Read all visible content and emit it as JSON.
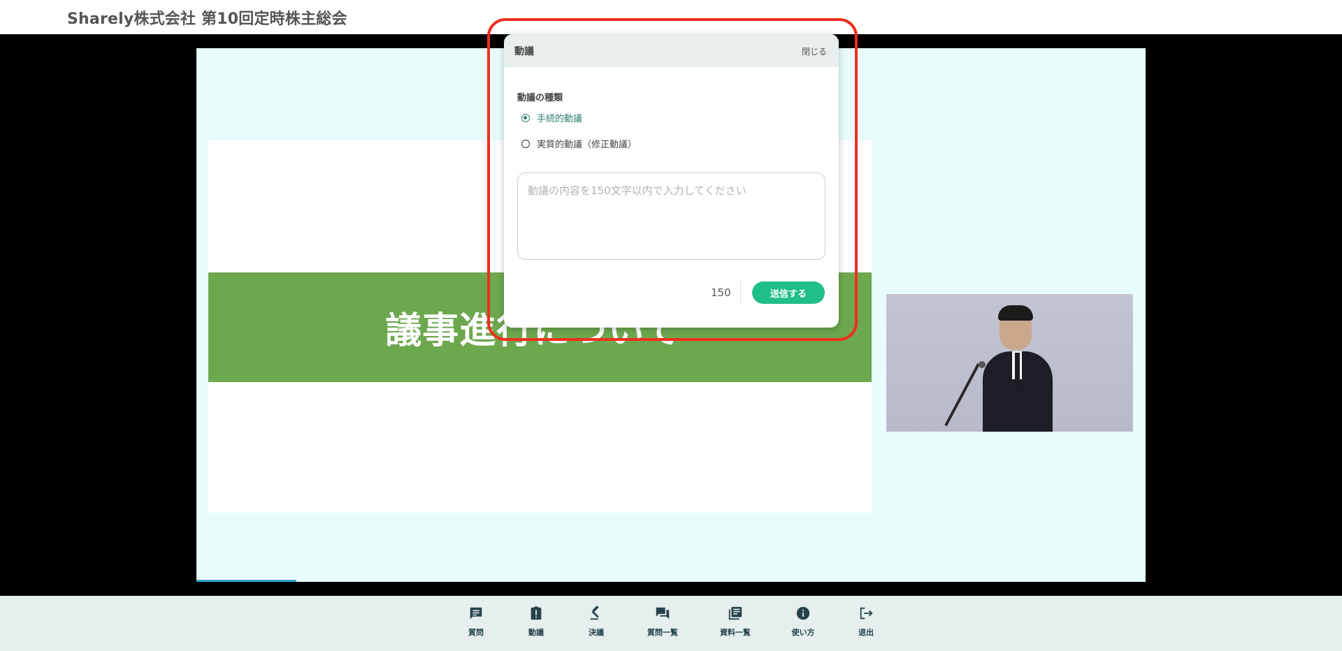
{
  "header": {
    "title": "Sharely株式会社 第10回定時株主総会"
  },
  "slide": {
    "band_text": "議事進行について"
  },
  "dialog": {
    "title": "動議",
    "close_label": "閉じる",
    "section_label": "動議の種類",
    "options": [
      {
        "label": "手続的動議",
        "selected": true
      },
      {
        "label": "実質的動議（修正動議）",
        "selected": false
      }
    ],
    "textarea": {
      "value": "",
      "placeholder": "動議の内容を150文字以内で入力してください"
    },
    "char_count": "150",
    "submit_label": "送信する"
  },
  "toolbar": {
    "items": [
      {
        "label": "質問",
        "icon": "chat-icon"
      },
      {
        "label": "動議",
        "icon": "clipboard-alert-icon"
      },
      {
        "label": "決議",
        "icon": "gavel-icon"
      },
      {
        "label": "質問一覧",
        "icon": "forum-icon"
      },
      {
        "label": "資料一覧",
        "icon": "library-icon"
      },
      {
        "label": "使い方",
        "icon": "info-icon"
      },
      {
        "label": "退出",
        "icon": "logout-icon"
      }
    ]
  },
  "colors": {
    "accent": "#1fbe8a",
    "highlight": "#ef2e1d",
    "band": "#6da84f",
    "toolbar_text": "#244249"
  }
}
